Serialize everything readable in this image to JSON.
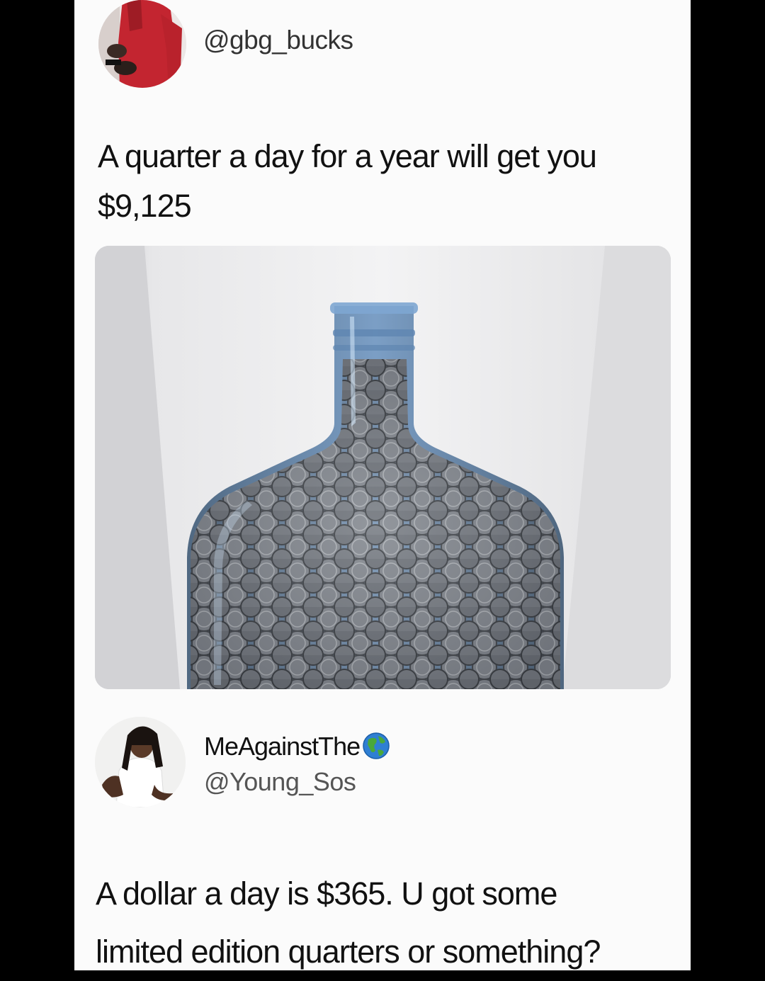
{
  "colors": {
    "page_background": "#fbfbfb",
    "frame": "#000000",
    "bottle_tint": "#5d86b4"
  },
  "tweet": {
    "author_handle": "@gbg_bucks",
    "text_lines": [
      "A quarter a day for a year will get you",
      "$9,125"
    ],
    "image_icon": "water-jug-full-of-quarters-photo"
  },
  "reply": {
    "display_name": "MeAgainstThe",
    "display_name_emoji": "globe-americas-icon",
    "author_handle": "@Young_Sos",
    "text_lines": [
      "A dollar a day is $365. U got some",
      "limited edition quarters or something?"
    ]
  }
}
